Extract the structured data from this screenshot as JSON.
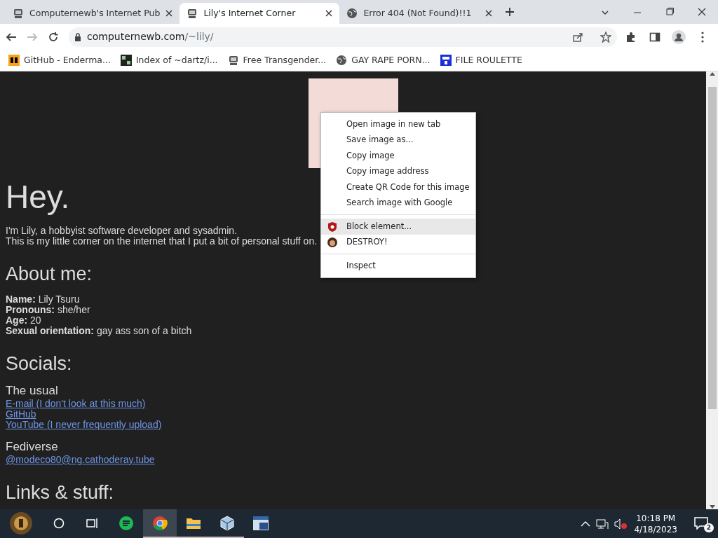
{
  "tabs": [
    {
      "title": "Computernewb's Internet Pub",
      "selected": false
    },
    {
      "title": "Lily's Internet Corner",
      "selected": true
    },
    {
      "title": "Error 404 (Not Found)!!1",
      "selected": false
    }
  ],
  "address": {
    "host": "computernewb.com",
    "path": "/~lily/"
  },
  "bookmarks": [
    {
      "label": "GitHub - Enderma..."
    },
    {
      "label": "Index of ~dartz/i..."
    },
    {
      "label": "Free Transgender..."
    },
    {
      "label": "GAY RAPE PORN..."
    },
    {
      "label": "FILE ROULETTE"
    }
  ],
  "page": {
    "heading": "Hey.",
    "intro": [
      "I'm Lily, a hobbyist software developer and sysadmin.",
      "This is my little corner on the internet that I put a bit of personal stuff on."
    ],
    "about_heading": "About me:",
    "facts": [
      {
        "label": "Name:",
        "value": "Lily Tsuru"
      },
      {
        "label": "Pronouns:",
        "value": "she/her"
      },
      {
        "label": "Age:",
        "value": "20"
      },
      {
        "label": "Sexual orientation:",
        "value": "gay ass son of a bitch"
      }
    ],
    "socials_heading": "Socials:",
    "social_groups": [
      {
        "title": "The usual",
        "links": [
          "E-mail (I don't look at this much)",
          "GitHub",
          "YouTube (I never frequently upload)"
        ]
      },
      {
        "title": "Fediverse",
        "links": [
          "@modeco80@ng.cathoderay.tube"
        ]
      }
    ],
    "links_heading": "Links & stuff:"
  },
  "context_menu": [
    {
      "kind": "item",
      "label": "Open image in new tab",
      "highlighted": false
    },
    {
      "kind": "item",
      "label": "Save image as...",
      "highlighted": false
    },
    {
      "kind": "item",
      "label": "Copy image",
      "highlighted": false
    },
    {
      "kind": "item",
      "label": "Copy image address",
      "highlighted": false
    },
    {
      "kind": "item",
      "label": "Create QR Code for this image",
      "highlighted": false
    },
    {
      "kind": "item",
      "label": "Search image with Google",
      "highlighted": false
    },
    {
      "kind": "separator"
    },
    {
      "kind": "item",
      "label": "Block element...",
      "highlighted": true
    },
    {
      "kind": "item",
      "label": "DESTROY!",
      "highlighted": false
    },
    {
      "kind": "separator"
    },
    {
      "kind": "item",
      "label": "Inspect",
      "highlighted": false
    }
  ],
  "taskbar": {
    "apps": [
      {
        "selected": false,
        "running": false
      },
      {
        "selected": true,
        "running": true
      },
      {
        "selected": false,
        "running": true
      },
      {
        "selected": false,
        "running": true
      },
      {
        "selected": false,
        "running": false
      }
    ],
    "time": "10:18 PM",
    "date": "4/18/2023",
    "notifications": "2"
  }
}
